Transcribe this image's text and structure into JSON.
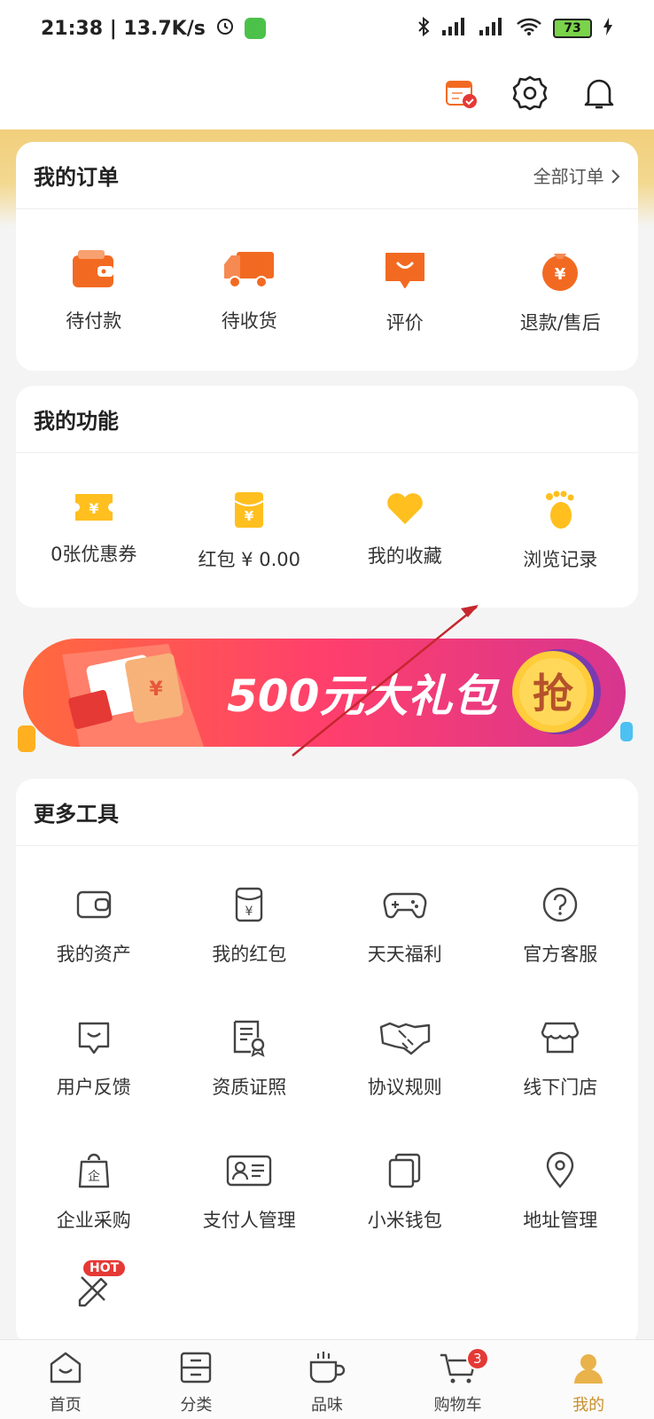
{
  "status_bar": {
    "time_speed": "21:38 | 13.7K/s",
    "battery": "73"
  },
  "top_bar": {
    "icons": [
      "calendar-check-icon",
      "gear-icon",
      "bell-icon"
    ]
  },
  "orders": {
    "title": "我的订单",
    "all_link": "全部订单",
    "items": [
      {
        "label": "待付款",
        "icon": "wallet-icon"
      },
      {
        "label": "待收货",
        "icon": "truck-icon"
      },
      {
        "label": "评价",
        "icon": "comment-icon"
      },
      {
        "label": "退款/售后",
        "icon": "refund-icon"
      }
    ]
  },
  "functions": {
    "title": "我的功能",
    "items": [
      {
        "label": "0张优惠券",
        "icon": "coupon-icon"
      },
      {
        "label": "红包 ¥ 0.00",
        "icon": "red-envelope-icon"
      },
      {
        "label": "我的收藏",
        "icon": "heart-icon"
      },
      {
        "label": "浏览记录",
        "icon": "footprint-icon"
      }
    ]
  },
  "banner": {
    "text": "500元大礼包",
    "button": "抢"
  },
  "tools": {
    "title": "更多工具",
    "items": [
      {
        "label": "我的资产",
        "icon": "wallet-outline-icon"
      },
      {
        "label": "我的红包",
        "icon": "envelope-outline-icon"
      },
      {
        "label": "天天福利",
        "icon": "gamepad-icon"
      },
      {
        "label": "官方客服",
        "icon": "question-icon"
      },
      {
        "label": "用户反馈",
        "icon": "feedback-icon"
      },
      {
        "label": "资质证照",
        "icon": "certificate-icon"
      },
      {
        "label": "协议规则",
        "icon": "handshake-icon"
      },
      {
        "label": "线下门店",
        "icon": "store-icon"
      },
      {
        "label": "企业采购",
        "icon": "enterprise-bag-icon"
      },
      {
        "label": "支付人管理",
        "icon": "id-card-icon"
      },
      {
        "label": "小米钱包",
        "icon": "cards-icon"
      },
      {
        "label": "地址管理",
        "icon": "location-pin-icon"
      }
    ],
    "hot_badge": "HOT"
  },
  "bottom_nav": {
    "tabs": [
      {
        "label": "首页",
        "icon": "home-icon"
      },
      {
        "label": "分类",
        "icon": "category-icon"
      },
      {
        "label": "品味",
        "icon": "cup-icon"
      },
      {
        "label": "购物车",
        "icon": "cart-icon",
        "badge": "3"
      },
      {
        "label": "我的",
        "icon": "user-icon"
      }
    ]
  },
  "colors": {
    "accent": "#f26a22",
    "gold": "#f1cf7c",
    "cart_badge": "#e53935"
  }
}
